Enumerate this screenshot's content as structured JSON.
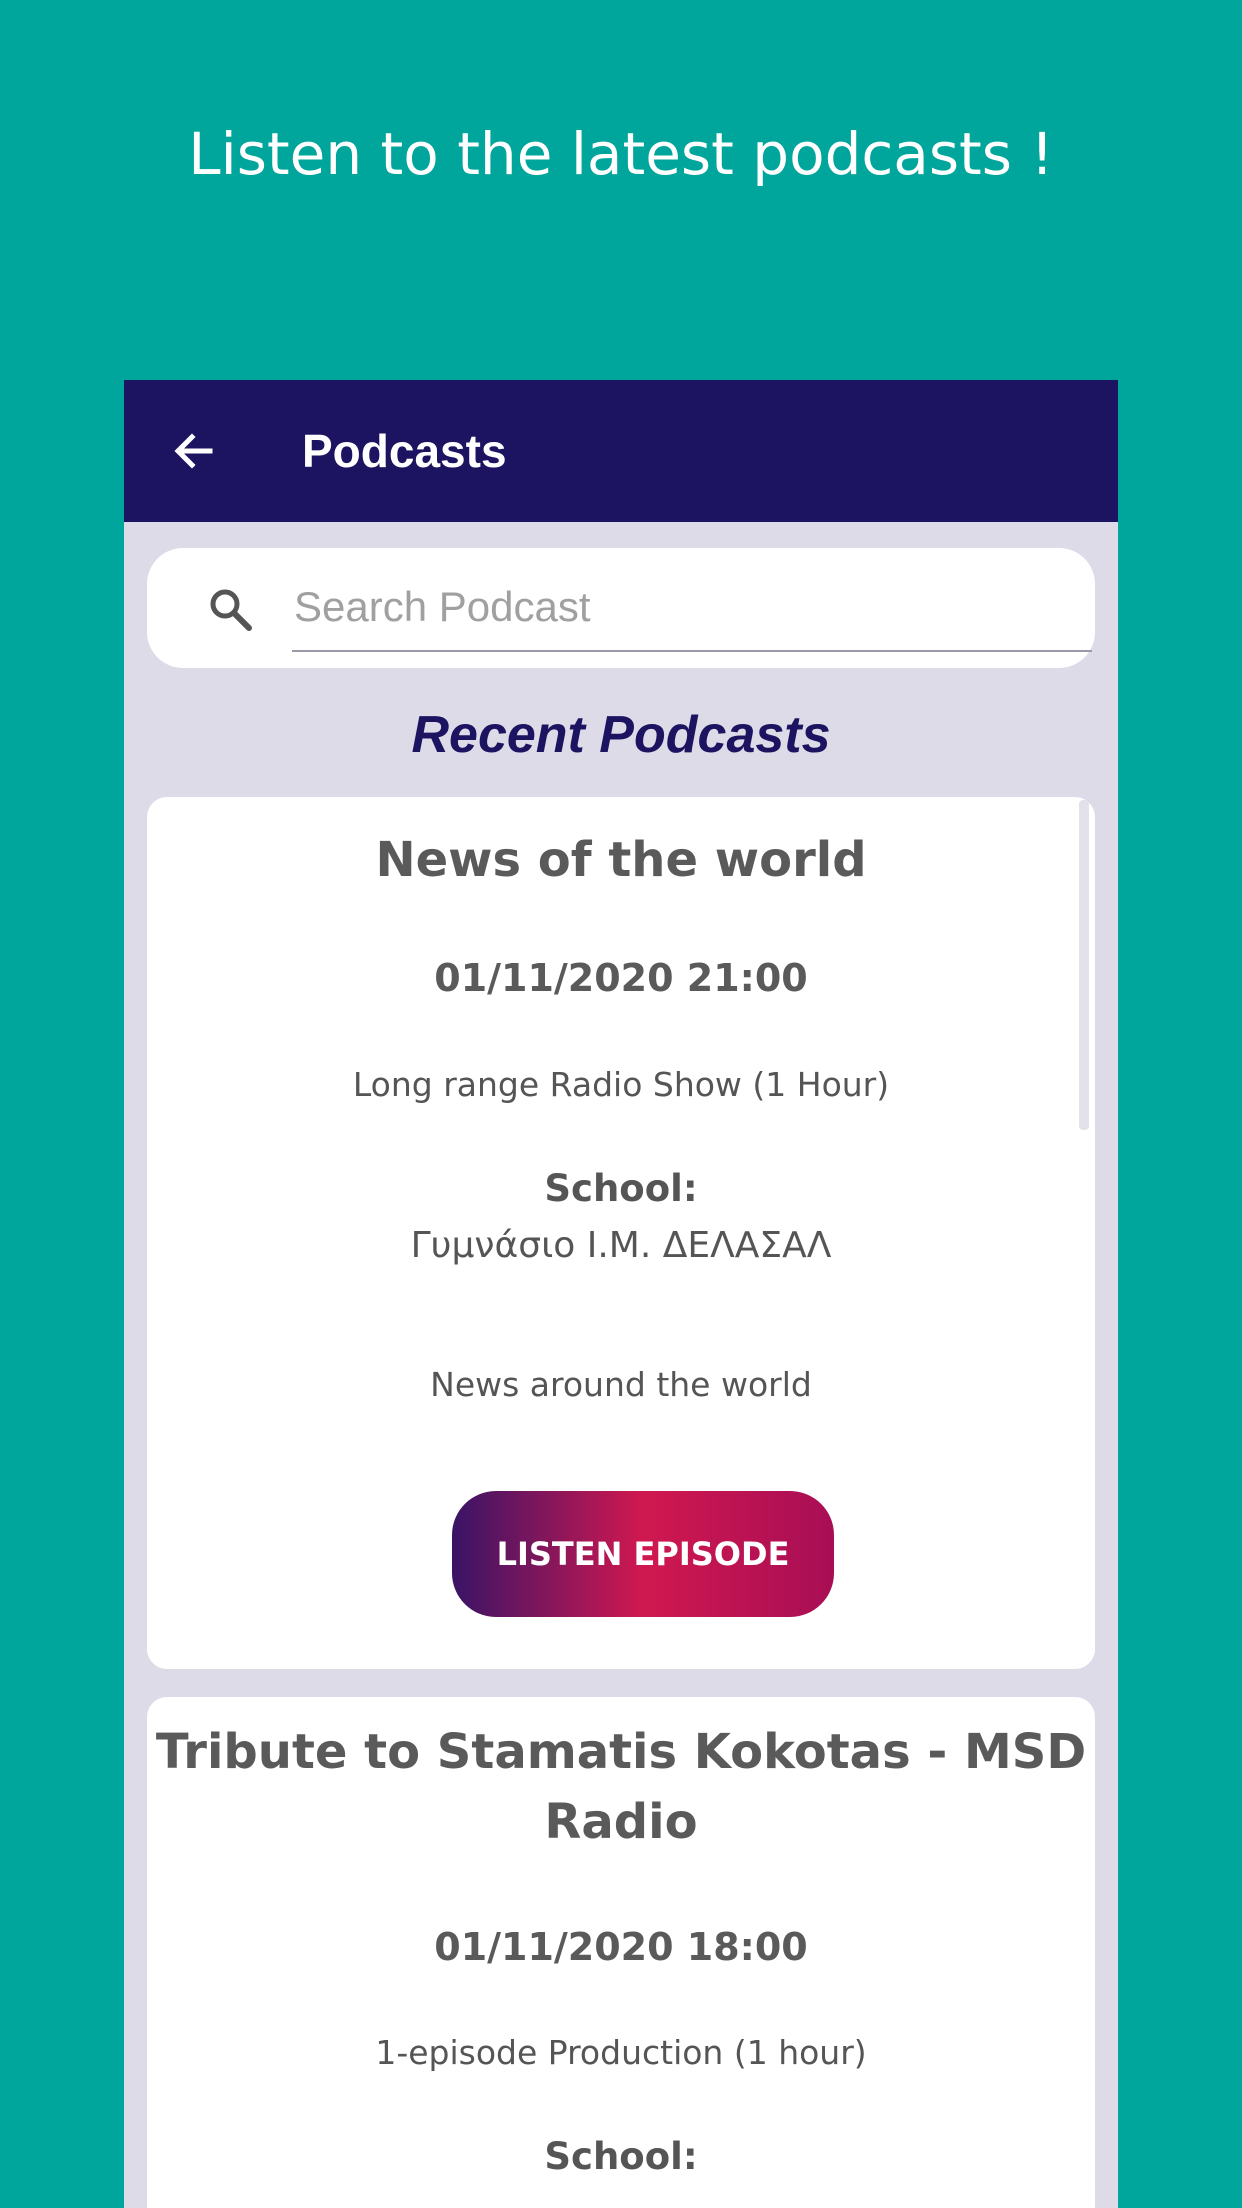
{
  "promo": {
    "caption": "Listen to the latest podcasts !"
  },
  "appbar": {
    "title": "Podcasts",
    "back_icon": "arrow-left-icon"
  },
  "search": {
    "placeholder": "Search Podcast",
    "icon": "search-icon"
  },
  "section": {
    "title": "Recent Podcasts"
  },
  "podcasts": [
    {
      "title": "News of the world",
      "date": "01/11/2020 21:00",
      "type": "Long range Radio Show (1 Hour)",
      "school_label": "School:",
      "school_name": "Γυμνάσιο Ι.Μ. ΔΕΛΑΣΑΛ",
      "description": "News around the world",
      "button": "LISTEN EPISODE"
    },
    {
      "title_line1": "Tribute to Stamatis Kokotas - MSD",
      "title_line2": "Radio",
      "date": "01/11/2020 18:00",
      "type": "1-episode Production (1 hour)",
      "school_label": "School:"
    }
  ],
  "colors": {
    "background": "#00a59b",
    "appbar": "#1c1460",
    "content_bg": "#dedbe8",
    "button_gradient": [
      "#3a1466",
      "#d01850",
      "#a80e55"
    ]
  }
}
